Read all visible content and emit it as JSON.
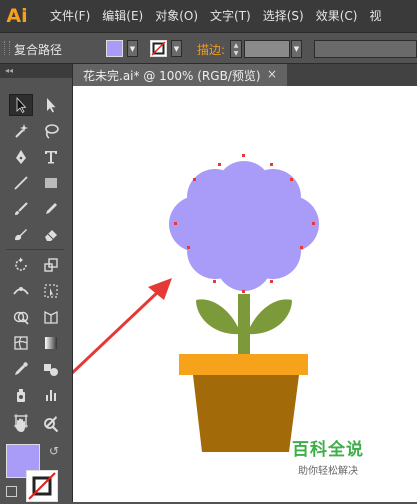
{
  "app": {
    "logo": "Ai"
  },
  "menu": {
    "items": [
      "文件(F)",
      "编辑(E)",
      "对象(O)",
      "文字(T)",
      "选择(S)",
      "效果(C)",
      "视"
    ]
  },
  "control_bar": {
    "selection_label": "复合路径",
    "stroke_label": "描边:",
    "fill_color": "#a99cf9",
    "stroke_color": "none"
  },
  "toolbar": {
    "collapse_glyph": "◂◂"
  },
  "document": {
    "tab_title": "花未完.ai* @ 100% (RGB/预览)",
    "close_glyph": "×"
  },
  "artwork": {
    "flower_color": "#a99cf9",
    "leaf_color": "#7d9a3a",
    "pot_rim_color": "#f7a21b",
    "pot_body_color": "#a36a0a",
    "arrow_color": "#e53935"
  },
  "watermark": {
    "title": "百科全说",
    "subtitle": "助你轻松解决"
  }
}
